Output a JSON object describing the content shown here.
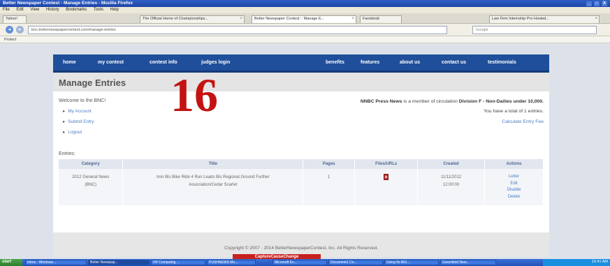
{
  "window": {
    "title": "Better Newspaper Contest - Manage Entries - Mozilla Firefox",
    "buttons": [
      "_",
      "□",
      "X"
    ]
  },
  "menu": [
    "File",
    "Edit",
    "View",
    "History",
    "Bookmarks",
    "Tools",
    "Help"
  ],
  "tabs": [
    {
      "label": "Yahoo!"
    },
    {
      "label": "The Official Home of Championships..."
    },
    {
      "label": "Better Newspaper Contest :: Manage E..."
    },
    {
      "label": "Facebook"
    },
    {
      "label": "Law Firm Internship Pro Hosted..."
    }
  ],
  "address": {
    "url": "bnc.betternewspapercontest.com/manage-entries",
    "search_placeholder": "Google"
  },
  "bookmarks": {
    "label": "Protect"
  },
  "site_nav": [
    "home",
    "my contest",
    "contest info",
    "judges login",
    "benefits",
    "features",
    "about us",
    "contact us",
    "testimonials"
  ],
  "page": {
    "title": "Manage Entries",
    "big_number": "16",
    "welcome": "Welcome to the BNC!",
    "links": [
      "My Account",
      "Submit Entry",
      "Logout"
    ],
    "member_pre": "NNBC Press News",
    "member_mid": " is a member of circulation ",
    "member_division": "Division F - Non-Dailies under 10,000.",
    "total_entries": "You have a total of 1 entries.",
    "calculate_fee": "Calculate Entry Fee",
    "entries_label": "Entries:"
  },
  "table": {
    "headers": [
      "Category",
      "Title",
      "Pages",
      "Files/URLs",
      "Created",
      "Actions"
    ],
    "rows": [
      {
        "category_line1": "2012 General News",
        "category_line2": "(BNC)",
        "title_line1": "Iron Bis Bike Ride 4 Run Leads Bis Regional Ground Further",
        "title_line2": "Association/Cedar Scarlet",
        "pages": "1",
        "created_line1": "11/11/2012",
        "created_line2": "12:00:00",
        "actions": [
          "Letter",
          "Edit",
          "Disable",
          "Delete"
        ]
      }
    ]
  },
  "footer": "Copyright © 2007 - 2014 BetterNewspaperContest. Inc. All Rights Reserved.",
  "banner": "CaptureCauseChange",
  "taskbar": {
    "start": "start",
    "tasks": [
      "Inbox - Windows...",
      "Better Newspap...",
      "HP Computing ...",
      "PUSHNEWS Me...",
      "Microsoft Ex...",
      "Document1 Co...",
      "Using Ifs BIG ...",
      "Greenfield New..."
    ],
    "clock": "10:41 AM"
  },
  "colors": {
    "nav": "#1f4f9a",
    "accent": "#c41212",
    "link": "#4a7ec4"
  }
}
